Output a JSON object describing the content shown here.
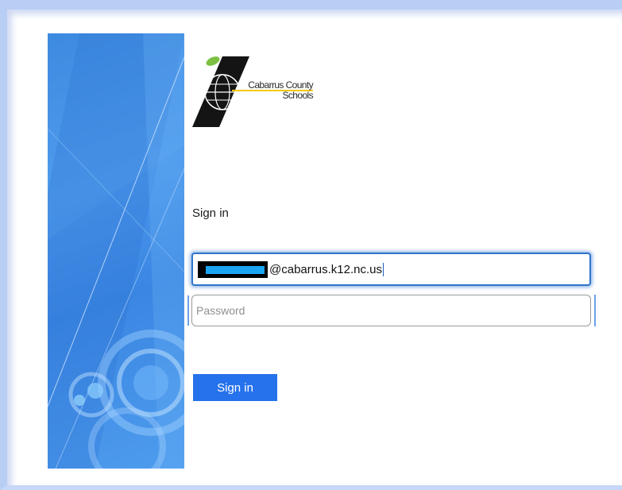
{
  "branding": {
    "logo_line1": "Cabarrus County",
    "logo_line2": "Schools"
  },
  "form": {
    "title": "Sign in",
    "email_value": "@cabarrus.k12.nc.us",
    "password_placeholder": "Password",
    "submit_label": "Sign in"
  },
  "colors": {
    "accent": "#2672ec",
    "hero": "#3a86e2",
    "focus_border": "#2f74c9"
  }
}
